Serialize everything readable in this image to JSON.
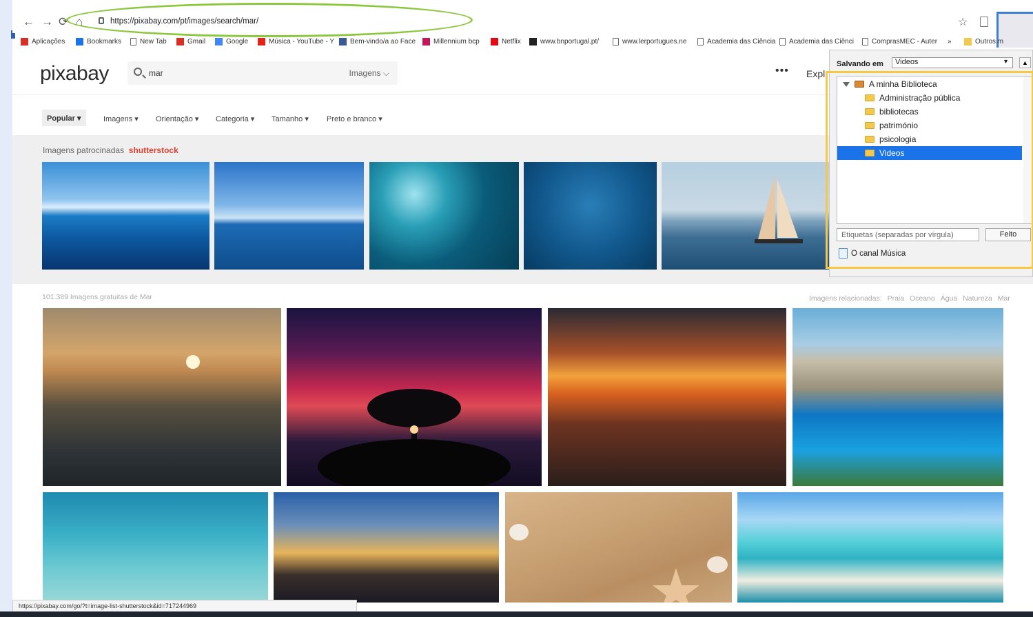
{
  "browser": {
    "url": "https://pixabay.com/pt/images/search/mar/",
    "bookmarks": [
      {
        "label": "Aplicações",
        "icon": "apps-grid-icon"
      },
      {
        "label": "Bookmarks",
        "icon": "star-icon"
      },
      {
        "label": "New Tab",
        "icon": "doc-icon"
      },
      {
        "label": "Gmail",
        "icon": "gmail-icon"
      },
      {
        "label": "Google",
        "icon": "google-icon"
      },
      {
        "label": "Música - YouTube - Y",
        "icon": "youtube-icon"
      },
      {
        "label": "Bem-vindo/a ao Face",
        "icon": "facebook-icon"
      },
      {
        "label": "Millennium bcp",
        "icon": "millennium-icon"
      },
      {
        "label": "Netflix",
        "icon": "netflix-icon"
      },
      {
        "label": "www.bnportugal.pt/",
        "icon": "bnp-icon"
      },
      {
        "label": "www.lerportugues.ne",
        "icon": "doc-icon"
      },
      {
        "label": "Academia das Ciência",
        "icon": "doc-icon"
      },
      {
        "label": "Academia das Ciênci",
        "icon": "doc-icon"
      },
      {
        "label": "ComprasMEC - Auter",
        "icon": "doc-icon"
      },
      {
        "label": "»",
        "icon": ""
      },
      {
        "label": "Outros m",
        "icon": "folder-icon"
      }
    ],
    "status_url": "https://pixabay.com/go/?t=image-list-shutterstock&id=717244969"
  },
  "header": {
    "logo": "pixabay",
    "search_query": "mar",
    "search_type": "Imagens",
    "more": "•••",
    "explore": "Expl"
  },
  "filters": [
    "Popular",
    "Imagens",
    "Orientação",
    "Categoria",
    "Tamanho",
    "Preto e branco"
  ],
  "sponsored": {
    "label": "Imagens patrocinadas",
    "brand": "shutterstock"
  },
  "results": {
    "count_text": "101.389 Imagens gratuitas de Mar",
    "related_label": "Imagens relacionadas:",
    "related": [
      "Praia",
      "Oceano",
      "Água",
      "Natureza",
      "Mar"
    ]
  },
  "save_panel": {
    "label": "Salvando em",
    "selected": "Videos",
    "tree": [
      {
        "label": "A minha Biblioteca",
        "level": 0,
        "selected": false
      },
      {
        "label": "Administração pública",
        "level": 1,
        "selected": false
      },
      {
        "label": "bibliotecas",
        "level": 1,
        "selected": false
      },
      {
        "label": "património",
        "level": 1,
        "selected": false
      },
      {
        "label": "psicologia",
        "level": 1,
        "selected": false
      },
      {
        "label": "Videos",
        "level": 1,
        "selected": true
      }
    ],
    "tags_placeholder": "Etiquetas (separadas por vírgula)",
    "done_label": "Feito",
    "note_label": "O canal Música"
  },
  "colors": {
    "ellipse_highlight": "#8dc63f",
    "panel_highlight": "#f6c843",
    "selection": "#1a73e8",
    "shutterstock_red": "#e2402d"
  }
}
